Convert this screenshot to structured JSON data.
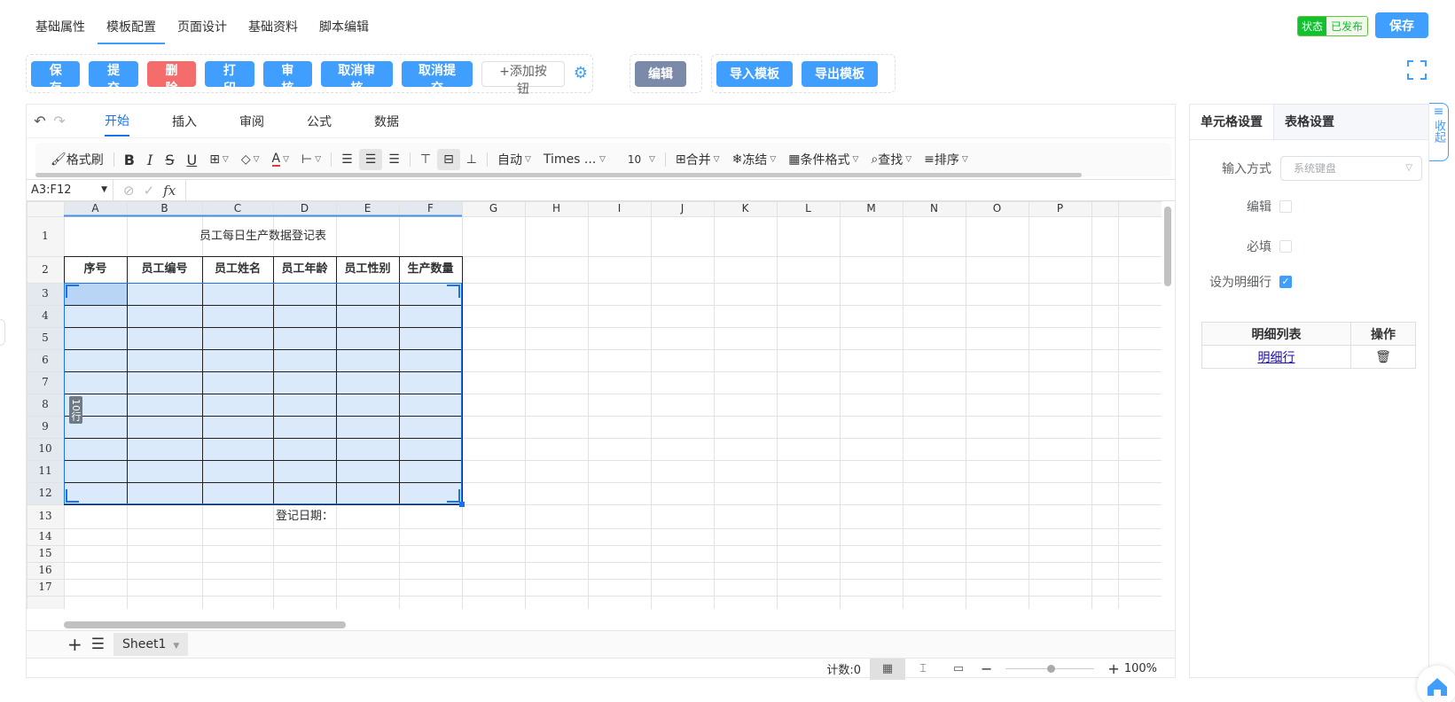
{
  "top_tabs": [
    {
      "label": "基础属性",
      "active": false
    },
    {
      "label": "模板配置",
      "active": true
    },
    {
      "label": "页面设计",
      "active": false
    },
    {
      "label": "基础资料",
      "active": false
    },
    {
      "label": "脚本编辑",
      "active": false
    }
  ],
  "status": {
    "key": "状态",
    "value": "已发布"
  },
  "save_top_label": "保存",
  "action_buttons": {
    "save": "保存",
    "submit": "提交",
    "delete": "删除",
    "print": "打印",
    "audit": "审核",
    "cancel_audit": "取消审核",
    "cancel_submit": "取消提交",
    "add_button": "+添加按钮",
    "edit": "编辑",
    "import_template": "导入模板",
    "export_template": "导出模板"
  },
  "menu_tabs": [
    "开始",
    "插入",
    "审阅",
    "公式",
    "数据"
  ],
  "toolbar": {
    "format_painter": "格式刷",
    "bold": "B",
    "italic": "I",
    "strike": "S",
    "underline": "U",
    "font_color": "A",
    "wrap": "自动",
    "font_family": "Times ...",
    "font_size": "10",
    "merge": "合并",
    "freeze": "冻结",
    "cond_format": "条件格式",
    "find": "查找",
    "sort": "排序"
  },
  "formula_bar": {
    "cell_ref": "A3:F12",
    "fx": "fx"
  },
  "columns": [
    "A",
    "B",
    "C",
    "D",
    "E",
    "F",
    "G",
    "H",
    "I",
    "J",
    "K",
    "L",
    "M",
    "N",
    "O",
    "P"
  ],
  "rows": [
    "1",
    "2",
    "3",
    "4",
    "5",
    "6",
    "7",
    "8",
    "9",
    "10",
    "11",
    "12",
    "13",
    "14",
    "15",
    "16",
    "17"
  ],
  "sheet": {
    "title": "员工每日生产数据登记表",
    "headers": [
      "序号",
      "员工编号",
      "员工姓名",
      "员工年龄",
      "员工性别",
      "生产数量"
    ],
    "date_label": "登记日期：",
    "selection_badge": "10行"
  },
  "sheet_tab": "Sheet1",
  "status_bar": {
    "count": "计数:0",
    "zoom": "100%"
  },
  "right_panel": {
    "tabs": [
      "单元格设置",
      "表格设置"
    ],
    "input_mode_label": "输入方式",
    "input_mode_placeholder": "系统键盘",
    "edit_label": "编辑",
    "required_label": "必填",
    "detail_row_label": "设为明细行",
    "detail_row_checked": true,
    "table_headers": [
      "明细列表",
      "操作"
    ],
    "table_rows": [
      {
        "name": "明细行"
      }
    ]
  },
  "collapse_label": "收起",
  "colors": {
    "primary": "#409eff",
    "danger": "#f56c6c",
    "gray": "#7b8aa8",
    "published": "#13c130",
    "selection": "#dbeafa"
  }
}
